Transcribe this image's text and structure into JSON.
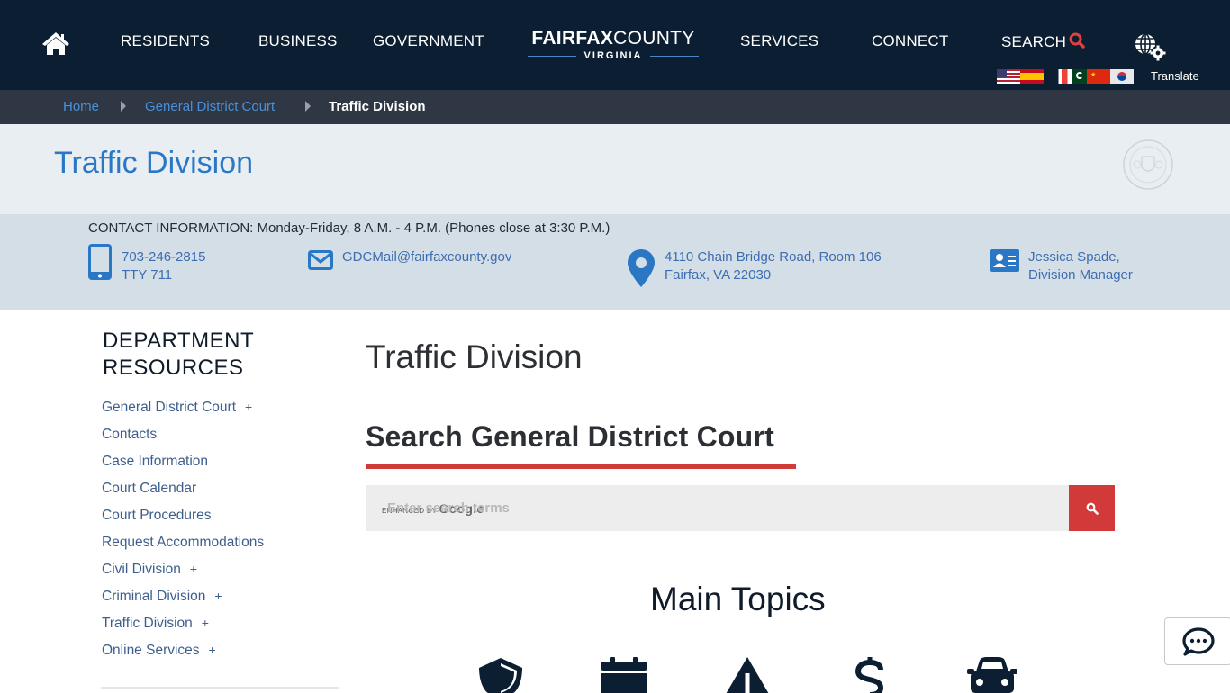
{
  "nav": {
    "items": [
      "RESIDENTS",
      "BUSINESS",
      "GOVERNMENT",
      "SERVICES",
      "CONNECT"
    ],
    "search_label": "SEARCH",
    "logo": {
      "strong": "FAIRFAX",
      "light": "COUNTY",
      "sub": "VIRGINIA"
    },
    "translate_label": "Translate",
    "flags": [
      "English",
      "Spanish",
      "French",
      "Urdu",
      "Chinese",
      "Korean"
    ]
  },
  "breadcrumb": {
    "items": [
      {
        "label": "Home",
        "link": true
      },
      {
        "label": "General District Court",
        "link": true
      },
      {
        "label": "Traffic Division",
        "link": false
      }
    ]
  },
  "page": {
    "banner_title": "Traffic Division"
  },
  "contact": {
    "heading": "CONTACT INFORMATION: Monday-Friday, 8 A.M. - 4 P.M. (Phones close at 3:30 P.M.)",
    "phone": "703-246-2815",
    "tty": "TTY 711",
    "email": "GDCMail@fairfaxcounty.gov",
    "address_line1": "4110 Chain Bridge Road, Room 106",
    "address_line2": "Fairfax, VA 22030",
    "manager_name": "Jessica Spade,",
    "manager_title": "Division Manager"
  },
  "sidebar": {
    "title_line1": "DEPARTMENT",
    "title_line2": "RESOURCES",
    "items": [
      {
        "label": "General District Court",
        "expandable": "+"
      },
      {
        "label": "Contacts",
        "expandable": ""
      },
      {
        "label": "Case Information",
        "expandable": ""
      },
      {
        "label": "Court Calendar",
        "expandable": ""
      },
      {
        "label": "Court Procedures",
        "expandable": ""
      },
      {
        "label": "Request Accommodations",
        "expandable": ""
      },
      {
        "label": "Civil Division",
        "expandable": "+"
      },
      {
        "label": "Criminal Division",
        "expandable": "+"
      },
      {
        "label": "Traffic Division",
        "expandable": "+"
      },
      {
        "label": "Online Services",
        "expandable": "+"
      }
    ]
  },
  "main": {
    "title": "Traffic Division",
    "search_heading": "Search General District Court",
    "search_placeholder": "Enter search terms",
    "enhanced_by": "ENHANCED BY",
    "google": "Google",
    "topics_heading": "Main Topics",
    "topic_icons": [
      "shield-icon",
      "calendar-icon",
      "warning-icon",
      "dollar-icon",
      "car-icon"
    ]
  },
  "colors": {
    "nav_bg": "#0c1e31",
    "breadcrumb_bg": "#2f3644",
    "link_blue": "#2a77c6",
    "accent_red": "#d23a3a",
    "contact_bg": "#d3dee6"
  }
}
